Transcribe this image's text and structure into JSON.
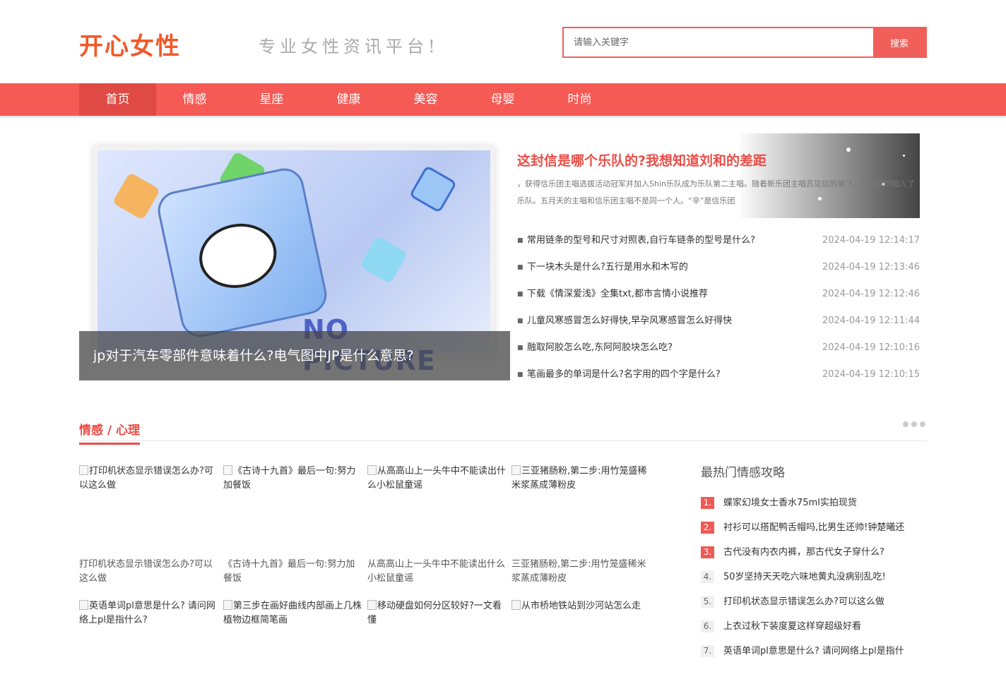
{
  "site": {
    "logo": "开心女性",
    "slogan": "专业女性资讯平台!"
  },
  "search": {
    "placeholder": "请输入关键字",
    "button_label": "搜索"
  },
  "nav": {
    "items": [
      "首页",
      "情感",
      "星座",
      "健康",
      "美容",
      "母婴",
      "时尚"
    ],
    "active_index": 0
  },
  "focus": {
    "image_text": "NO PICTURE",
    "caption": "jp对于汽车零部件意味着什么?电气图中JP是什么意思?"
  },
  "headline": {
    "title": "这封信是哪个乐队的?我想知道刘和的差距",
    "summary": "，获得信乐团主唱选拔活动冠军并加入Shin乐队成为乐队第二主唱。随着新乐团主唱苏见信的单飞，新主唱刘加入了乐队。五月天的主唱和信乐团主唱不是同一个人。“辛”是信乐团"
  },
  "news": [
    {
      "title": "常用链条的型号和尺寸对照表,自行车链条的型号是什么?",
      "time": "2024-04-19 12:14:17"
    },
    {
      "title": "下一块木头是什么?五行是用水和木写的",
      "time": "2024-04-19 12:13:46"
    },
    {
      "title": "下载《情深爱浅》全集txt,都市言情小说推荐",
      "time": "2024-04-19 12:12:46"
    },
    {
      "title": "儿童风寒感冒怎么好得快,早孕风寒感冒怎么好得快",
      "time": "2024-04-19 12:11:44"
    },
    {
      "title": "融取阿胶怎么吃,东阿阿胶块怎么吃?",
      "time": "2024-04-19 12:10:16"
    },
    {
      "title": "笔画最多的单词是什么?名字用的四个字是什么?",
      "time": "2024-04-19 12:10:15"
    }
  ],
  "section": {
    "title": "情感 / 心理"
  },
  "cards": [
    {
      "alt": "打印机状态显示错误怎么办?可以这么做",
      "caption": "打印机状态显示错误怎么办?可以这么做"
    },
    {
      "alt": "《古诗十九首》最后一句:努力加餐饭",
      "caption": "《古诗十九首》最后一句:努力加餐饭"
    },
    {
      "alt": "从高高山上一头牛中不能读出什么小松鼠童谣",
      "caption": "从高高山上一头牛中不能读出什么小松鼠童谣"
    },
    {
      "alt": "三亚猪肠粉,第二步:用竹笼盛稀米浆蒸成薄粉皮",
      "caption": "三亚猪肠粉,第二步:用竹笼盛稀米浆蒸成薄粉皮"
    },
    {
      "alt": "英语单词pl意思是什么? 请问网络上pl是指什么?",
      "caption": ""
    },
    {
      "alt": "第三步在画好曲线内部画上几株植物边框简笔画",
      "caption": ""
    },
    {
      "alt": "移动硬盘如何分区较好?一文看懂",
      "caption": ""
    },
    {
      "alt": "从市桥地铁站到沙河站怎么走",
      "caption": ""
    }
  ],
  "hot": {
    "title": "最热门情感攻略",
    "items": [
      {
        "num": "1.",
        "text": "蝶家幻境女士香水75ml实拍现货"
      },
      {
        "num": "2.",
        "text": "衬衫可以搭配鸭舌帽吗,比男生还帅!钟楚曦还"
      },
      {
        "num": "3.",
        "text": "古代没有内衣内裤，那古代女子穿什么?"
      },
      {
        "num": "4.",
        "text": "50岁坚持天天吃六味地黄丸没病别乱吃!"
      },
      {
        "num": "5.",
        "text": "打印机状态显示错误怎么办?可以这么做"
      },
      {
        "num": "6.",
        "text": "上衣过秋下装度夏这样穿超级好看"
      },
      {
        "num": "7.",
        "text": "英语单词pl意思是什么? 请问网络上pl是指什"
      }
    ]
  },
  "colors": {
    "accent": "#f55a55",
    "title_red": "#e94d47"
  }
}
